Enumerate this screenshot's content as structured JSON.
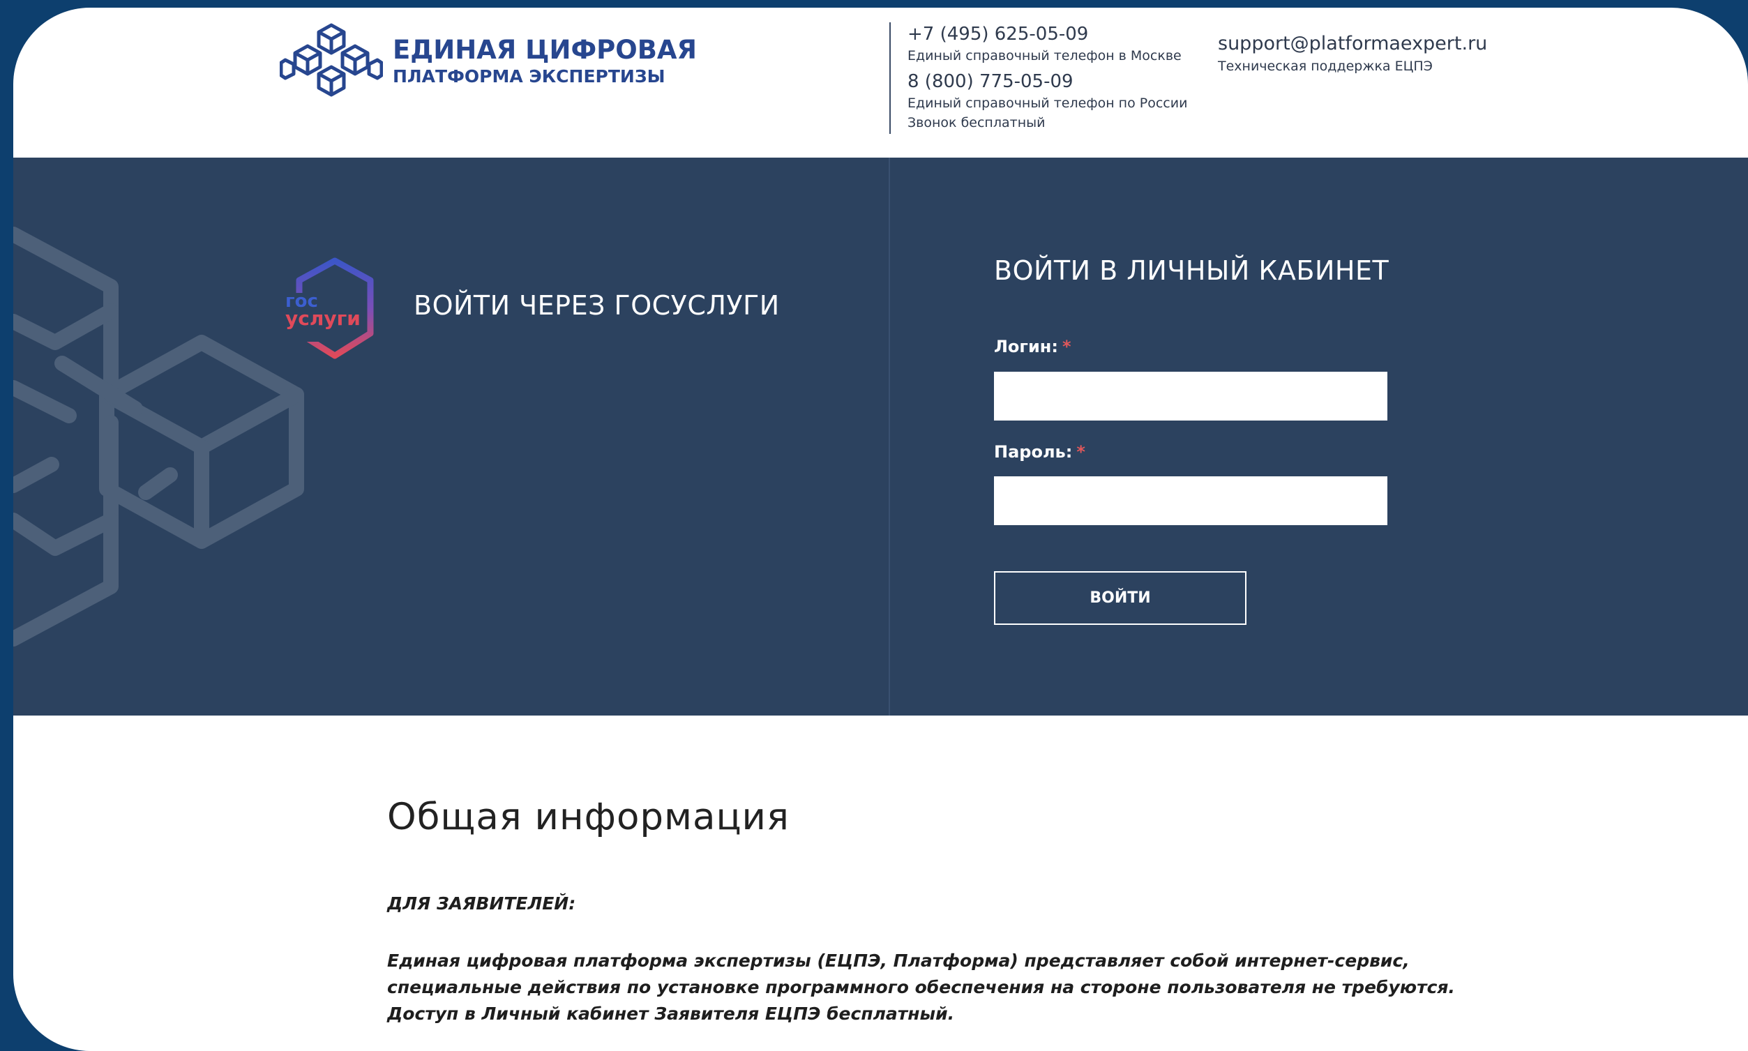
{
  "header": {
    "logo_line1": "ЕДИНАЯ ЦИФРОВАЯ",
    "logo_line2": "ПЛАТФОРМА ЭКСПЕРТИЗЫ",
    "phone_moscow": "+7 (495) 625-05-09",
    "phone_moscow_caption": "Единый справочный телефон в Москве",
    "phone_russia": "8 (800) 775-05-09",
    "phone_russia_caption": "Единый справочный телефон по России",
    "phone_russia_note": "Звонок бесплатный",
    "support_email": "support@platformaexpert.ru",
    "support_caption": "Техническая поддержка ЕЦПЭ"
  },
  "gosuslugi": {
    "logo_top": "гос",
    "logo_bottom": "услуги",
    "title": "ВОЙТИ ЧЕРЕЗ ГОСУСЛУГИ"
  },
  "login": {
    "title": "ВОЙТИ В ЛИЧНЫЙ КАБИНЕТ",
    "login_label": "Логин:",
    "password_label": "Пароль:",
    "required_mark": "*",
    "login_value": "",
    "password_value": "",
    "submit_label": "ВОЙТИ"
  },
  "info": {
    "title": "Общая информация",
    "subtitle": "ДЛЯ ЗАЯВИТЕЛЕЙ:",
    "paragraph_lines": [
      "Единая цифровая платформа экспертизы (ЕЦПЭ, Платформа) представляет собой интернет-сервис,",
      "специальные действия по установке программного обеспечения на стороне пользователя не требуются.",
      "Доступ в Личный кабинет Заявителя ЕЦПЭ бесплатный."
    ]
  },
  "colors": {
    "page_border": "#0d3f6e",
    "band": "#2c425f",
    "logo_blue": "#27468f",
    "required": "#e0585b"
  }
}
